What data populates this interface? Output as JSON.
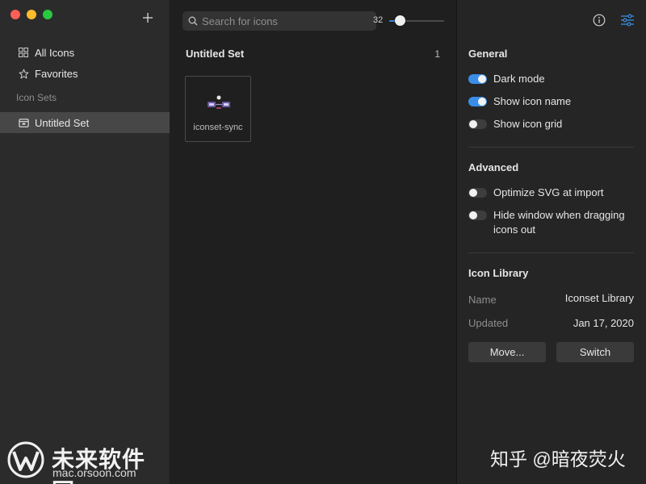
{
  "sidebar": {
    "items": [
      {
        "label": "All Icons",
        "icon": "grid-icon"
      },
      {
        "label": "Favorites",
        "icon": "star-icon"
      }
    ],
    "section_label": "Icon Sets",
    "sets": [
      {
        "label": "Untitled Set",
        "icon": "folder-icon",
        "selected": true
      }
    ]
  },
  "main": {
    "search": {
      "placeholder": "Search for icons",
      "value": ""
    },
    "icon_size": "32",
    "icon_size_fraction": 0.15,
    "set_title": "Untitled Set",
    "set_count": "1",
    "icons": [
      {
        "name": "iconset-sync"
      }
    ]
  },
  "inspector": {
    "general": {
      "title": "General",
      "toggles": [
        {
          "label": "Dark mode",
          "on": true
        },
        {
          "label": "Show icon name",
          "on": true
        },
        {
          "label": "Show icon grid",
          "on": false
        }
      ]
    },
    "advanced": {
      "title": "Advanced",
      "toggles": [
        {
          "label": "Optimize SVG at import",
          "on": false
        },
        {
          "label": "Hide window when dragging icons out",
          "on": false
        }
      ]
    },
    "library": {
      "title": "Icon Library",
      "name_key": "Name",
      "name_value": "Iconset Library",
      "updated_key": "Updated",
      "updated_value": "Jan 17, 2020",
      "move_label": "Move...",
      "switch_label": "Switch"
    }
  },
  "colors": {
    "accent": "#3a8ee6",
    "sidebar_bg": "#2b2b2b",
    "main_bg": "#1f1f1f",
    "inspector_bg": "#252525"
  },
  "watermark": {
    "left_text": "未来软件园",
    "left_url": "mac.orsoon.com",
    "right_text": "知乎 @暗夜荧火"
  }
}
